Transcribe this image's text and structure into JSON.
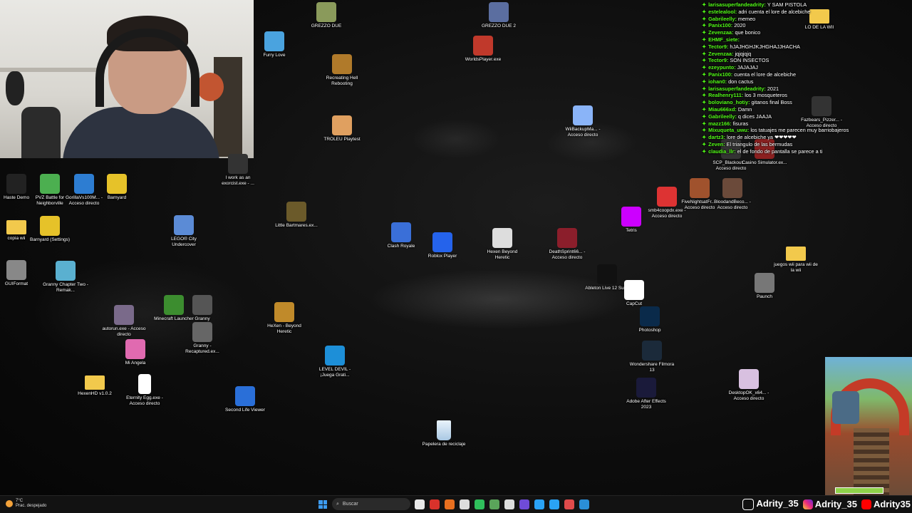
{
  "desktop_icons": [
    {
      "label": "GREZZO DUE",
      "icon": "app-icon",
      "color": "#8a9a5b"
    },
    {
      "label": "GREZZO DUE 2",
      "icon": "app-icon",
      "color": "#5b6ea0"
    },
    {
      "label": "Furry Love",
      "icon": "paw-icon",
      "color": "#4aa3df"
    },
    {
      "label": "WorldsPlayer.exe",
      "icon": "app-icon",
      "color": "#c0392b"
    },
    {
      "label": "Recreating Hell Rebooting",
      "icon": "app-icon",
      "color": "#b07a2a"
    },
    {
      "label": "TROLEU Playtest",
      "icon": "app-icon",
      "color": "#e0a060"
    },
    {
      "label": "WiiBackupMa... - Acceso directo",
      "icon": "app-icon",
      "color": "#8ab4f8"
    },
    {
      "label": "I work as an exorcist.exe - ...",
      "icon": "app-icon",
      "color": "#333333"
    },
    {
      "label": "Haste Demo",
      "icon": "app-icon",
      "color": "#222222"
    },
    {
      "label": "PVZ Battle for Neighborville",
      "icon": "app-icon",
      "color": "#4caf50"
    },
    {
      "label": "GorillaVs100M... - Acceso directo",
      "icon": "app-icon",
      "color": "#2d7dd2"
    },
    {
      "label": "Barnyard",
      "icon": "app-icon",
      "color": "#e6c229"
    },
    {
      "label": "copia wii",
      "icon": "folder-icon",
      "color": "#f2c94c"
    },
    {
      "label": "Barnyard (Settings)",
      "icon": "app-icon",
      "color": "#e6c229"
    },
    {
      "label": "LEGO® City Undercover",
      "icon": "app-icon",
      "color": "#5b8bd6"
    },
    {
      "label": "Little Bartmares.ex...",
      "icon": "app-icon",
      "color": "#6b5a2a"
    },
    {
      "label": "Clash Royale",
      "icon": "app-icon",
      "color": "#3a6fd8"
    },
    {
      "label": "Roblox Player",
      "icon": "app-icon",
      "color": "#2563eb"
    },
    {
      "label": "Hexen Beyond Heretic",
      "icon": "app-icon",
      "color": "#dddddd"
    },
    {
      "label": "DeathSprint66... - Acceso directo",
      "icon": "app-icon",
      "color": "#8b1e2b"
    },
    {
      "label": "smb4coopdx.exe - Acceso directo",
      "icon": "app-icon",
      "color": "#d33"
    },
    {
      "label": "FiveNightsatFr... - Acceso directo",
      "icon": "app-icon",
      "color": "#a0522d"
    },
    {
      "label": "BloodandBeco... - Acceso directo",
      "icon": "app-icon",
      "color": "#6b4a3a"
    },
    {
      "label": "Tetris",
      "icon": "app-icon",
      "color": "#c0f"
    },
    {
      "label": "GUIFormat",
      "icon": "app-icon",
      "color": "#888888"
    },
    {
      "label": "Granny Chapter Two - Remak...",
      "icon": "app-icon",
      "color": "#5ab0d0"
    },
    {
      "label": "juegos wii para wii de la wii",
      "icon": "folder-icon",
      "color": "#f2c94c"
    },
    {
      "label": "Ableton Live 12 Suite",
      "icon": "app-icon",
      "color": "#111111"
    },
    {
      "label": "CapCut",
      "icon": "app-icon",
      "color": "#ffffff"
    },
    {
      "label": "Paunch",
      "icon": "app-icon",
      "color": "#777777"
    },
    {
      "label": "autorun.exe - Acceso directo",
      "icon": "app-icon",
      "color": "#7a6a8a"
    },
    {
      "label": "Minecraft Launcher",
      "icon": "app-icon",
      "color": "#3c8d2f"
    },
    {
      "label": "Granny",
      "icon": "app-icon",
      "color": "#555555"
    },
    {
      "label": "HeXen - Beyond Heretic",
      "icon": "app-icon",
      "color": "#c08a2a"
    },
    {
      "label": "Granny - Recaptured.ex...",
      "icon": "app-icon",
      "color": "#666666"
    },
    {
      "label": "Photoshop",
      "icon": "app-icon",
      "color": "#0a2a4a"
    },
    {
      "label": "Mi Angela",
      "icon": "app-icon",
      "color": "#e06ab0"
    },
    {
      "label": "LEVEL DEVIL - ¡Juega Grati...",
      "icon": "app-icon",
      "color": "#1d8fd8"
    },
    {
      "label": "Wondershare Filmora 13",
      "icon": "app-icon",
      "color": "#1b2a3a"
    },
    {
      "label": "HexenHD v1.0.2",
      "icon": "folder-icon",
      "color": "#f2c94c"
    },
    {
      "label": "Eternity Egg.exe - Acceso directo",
      "icon": "file-icon",
      "color": "#ffffff"
    },
    {
      "label": "Second Life Viewer",
      "icon": "app-icon",
      "color": "#2a6fd8"
    },
    {
      "label": "Adobe After Effects 2023",
      "icon": "app-icon",
      "color": "#1a1a3a"
    },
    {
      "label": "DesktopOK_x64... - Acceso directo",
      "icon": "app-icon",
      "color": "#d8c0e0"
    },
    {
      "label": "Papelera de reciclaje",
      "icon": "recycle-bin-icon",
      "color": "#cfe3f5"
    },
    {
      "label": "LO DE LA WII",
      "icon": "folder-icon",
      "color": "#f2c94c"
    },
    {
      "label": "Fazbears_Pizzer... - Acceso directo",
      "icon": "app-icon",
      "color": "#333333"
    },
    {
      "label": "SCP_Blackout... - Acceso directo",
      "icon": "app-icon",
      "color": "#333333"
    },
    {
      "label": "Casino Simulator.ex...",
      "icon": "app-icon",
      "color": "#8b2020"
    }
  ],
  "chat": [
    {
      "user": "larisasuperfandeadrity",
      "msg": "Y SAM PISTOLA"
    },
    {
      "user": "estelealool",
      "msg": "adri cuenta el lore de alcebiche"
    },
    {
      "user": "Gabrileelly",
      "msg": "memeo"
    },
    {
      "user": "Panix100",
      "msg": "2020"
    },
    {
      "user": "Zevenzaa",
      "msg": "que bonico"
    },
    {
      "user": "EHMF_siete",
      "msg": ""
    },
    {
      "user": "Tector9",
      "msg": "hJAJHGHJKJHGHAJJHACHA"
    },
    {
      "user": "Zevenzaa",
      "msg": "jqjqjqjq"
    },
    {
      "user": "Tector9",
      "msg": "SON INSECTOS"
    },
    {
      "user": "ezeypunto",
      "msg": "JAJAJAJ"
    },
    {
      "user": "Panix100",
      "msg": "cuenta el lore de alcebiche"
    },
    {
      "user": "iohan0",
      "msg": "don cactus"
    },
    {
      "user": "larisasuperfandeadrity",
      "msg": "2021"
    },
    {
      "user": "Realhenry111",
      "msg": "los 3 mosqueteros"
    },
    {
      "user": "boloviano_hotiy",
      "msg": "gitanos final Boss"
    },
    {
      "user": "Miau666xd",
      "msg": "Damn"
    },
    {
      "user": "Gabrileelly",
      "msg": "q dices JAAJA"
    },
    {
      "user": "mazz166",
      "msg": "fisuras"
    },
    {
      "user": "Mixuqueta_uwu",
      "msg": "los tatuajes me parecen muy barriobajeros"
    },
    {
      "user": "dartz3",
      "msg": "lore de alcebiche ya ❤❤❤❤❤"
    },
    {
      "user": "Zeven",
      "msg": "El triangulo de las bermudas"
    },
    {
      "user": "claudia_llr",
      "msg": "el de fondo de pantalla se parece a ti"
    }
  ],
  "taskbar": {
    "weather_temp": "7°C",
    "weather_desc": "Prac. despejado",
    "search_placeholder": "Buscar",
    "apps": [
      "#e8e8e8",
      "#d9322b",
      "#e86f1f",
      "#dddddd",
      "#2fbf5b",
      "#5aa55a",
      "#dddddd",
      "#6f4bd8",
      "#2aa3f5",
      "#2aa3f5",
      "#e04b4b",
      "#2a8fd8"
    ]
  },
  "socials": {
    "tiktok": "Adrity_35",
    "instagram": "Adrity_35",
    "youtube": "Adrity35"
  },
  "colors": {
    "chat_user": "#53fc18",
    "start_blue": "#3d9bf0"
  }
}
